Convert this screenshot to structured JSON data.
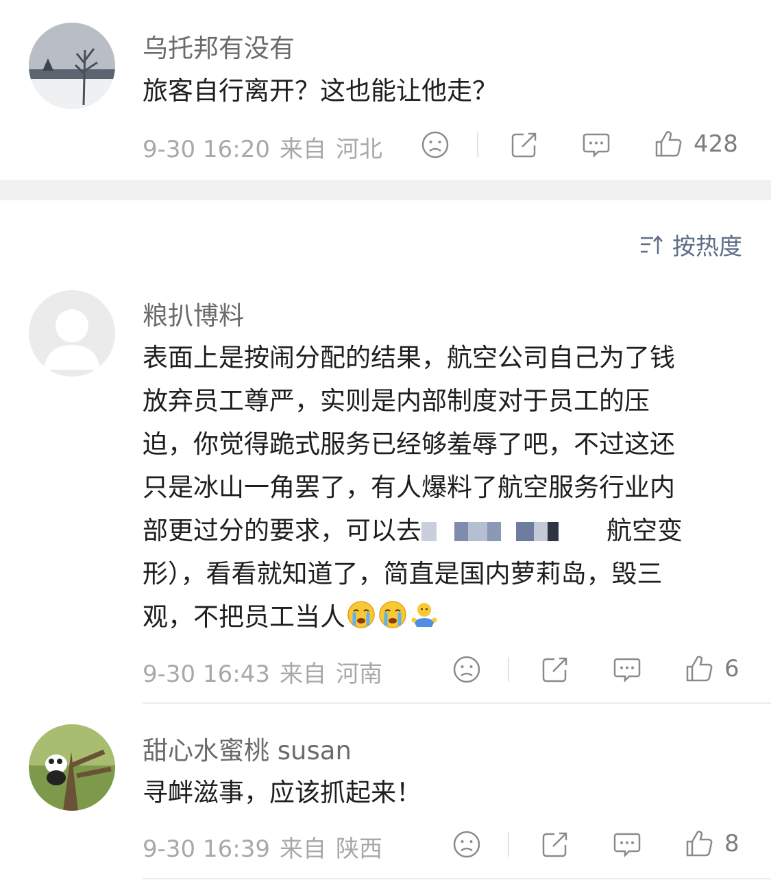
{
  "comments": [
    {
      "username": "乌托邦有没有",
      "content": "旅客自行离开？这也能让他走？",
      "time": "9-30 16:20",
      "from": "来自",
      "location": "河北",
      "likes": "428"
    },
    {
      "username": "粮扒博料",
      "content_lines": [
        "表面上是按闹分配的结果，航空公司自己为了钱",
        "放弃员工尊严，实则是内部制度对于员工的压",
        "迫，你觉得跪式服务已经够羞辱了吧，不过这还",
        "只是冰山一角罢了，有人爆料了航空服务行业内",
        "部更过分的要求，可以去",
        "航空变",
        "形），看看就知道了，简直是国内萝莉岛，毁三",
        "观，不把员工当人"
      ],
      "time": "9-30 16:43",
      "from": "来自",
      "location": "河南",
      "likes": "6"
    },
    {
      "username": "甜心水蜜桃 susan",
      "content": "寻衅滋事，应该抓起来！",
      "time": "9-30 16:39",
      "from": "来自",
      "location": "陕西",
      "likes": "8"
    }
  ],
  "sort_label": "按热度",
  "icons": [
    "sad-face-icon",
    "share-icon",
    "comment-icon",
    "thumbs-up-icon",
    "sort-icon",
    "crying-emoji-icon",
    "shrug-emoji-icon"
  ]
}
